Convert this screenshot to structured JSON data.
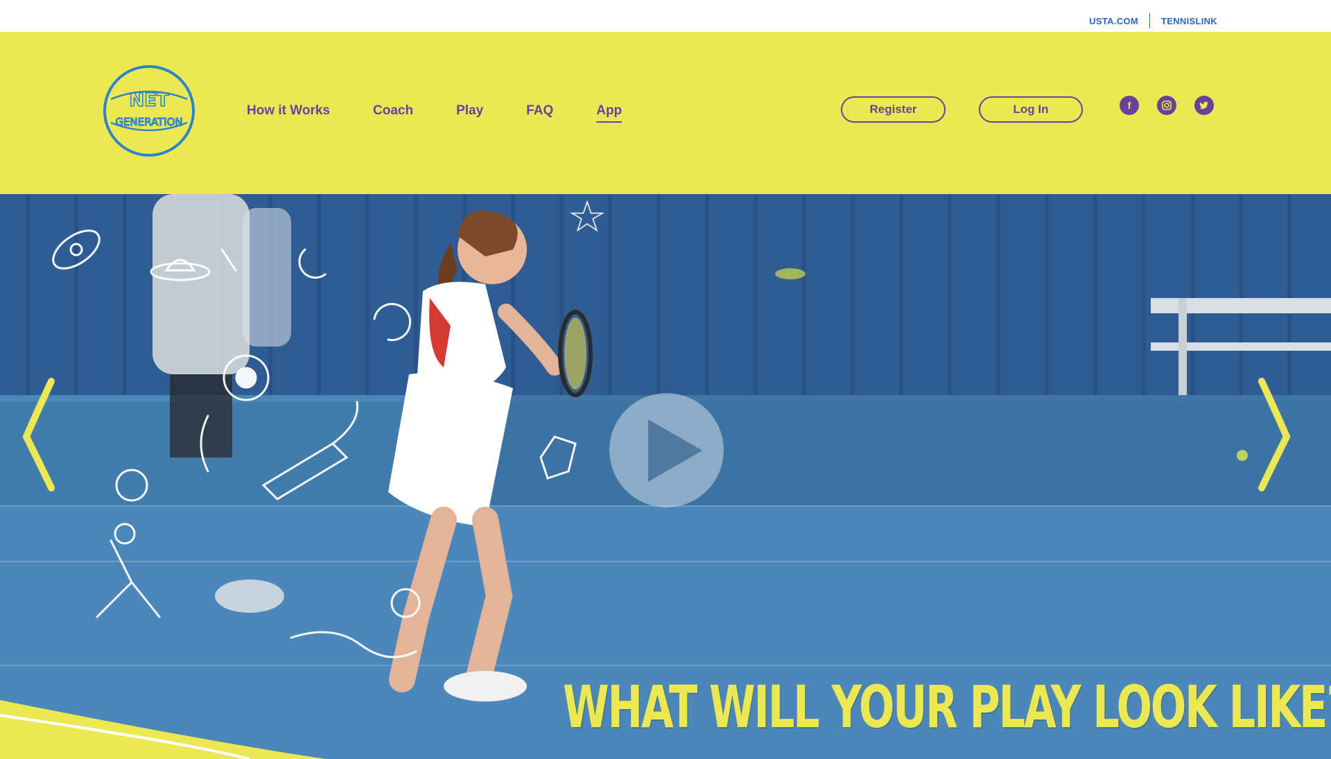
{
  "utility": {
    "links": [
      "USTA.COM",
      "TENNISLINK"
    ]
  },
  "brand": {
    "logo_text": "NET GENERATION"
  },
  "nav": {
    "items": [
      {
        "label": "How it Works",
        "active": false
      },
      {
        "label": "Coach",
        "active": false
      },
      {
        "label": "Play",
        "active": false
      },
      {
        "label": "FAQ",
        "active": false
      },
      {
        "label": "App",
        "active": true
      }
    ]
  },
  "auth": {
    "register_label": "Register",
    "login_label": "Log In"
  },
  "social": [
    "facebook-icon",
    "instagram-icon",
    "twitter-icon"
  ],
  "hero": {
    "headline": "WHAT WILL YOUR PLAY LOOK LIKE?",
    "icons": [
      "arrow-left-icon",
      "play-icon",
      "arrow-right-icon"
    ]
  },
  "colors": {
    "header_yellow": "#ece853",
    "purple": "#6b3f9e",
    "link_blue": "#2a68b8",
    "court_blue": "#3f78a8"
  }
}
